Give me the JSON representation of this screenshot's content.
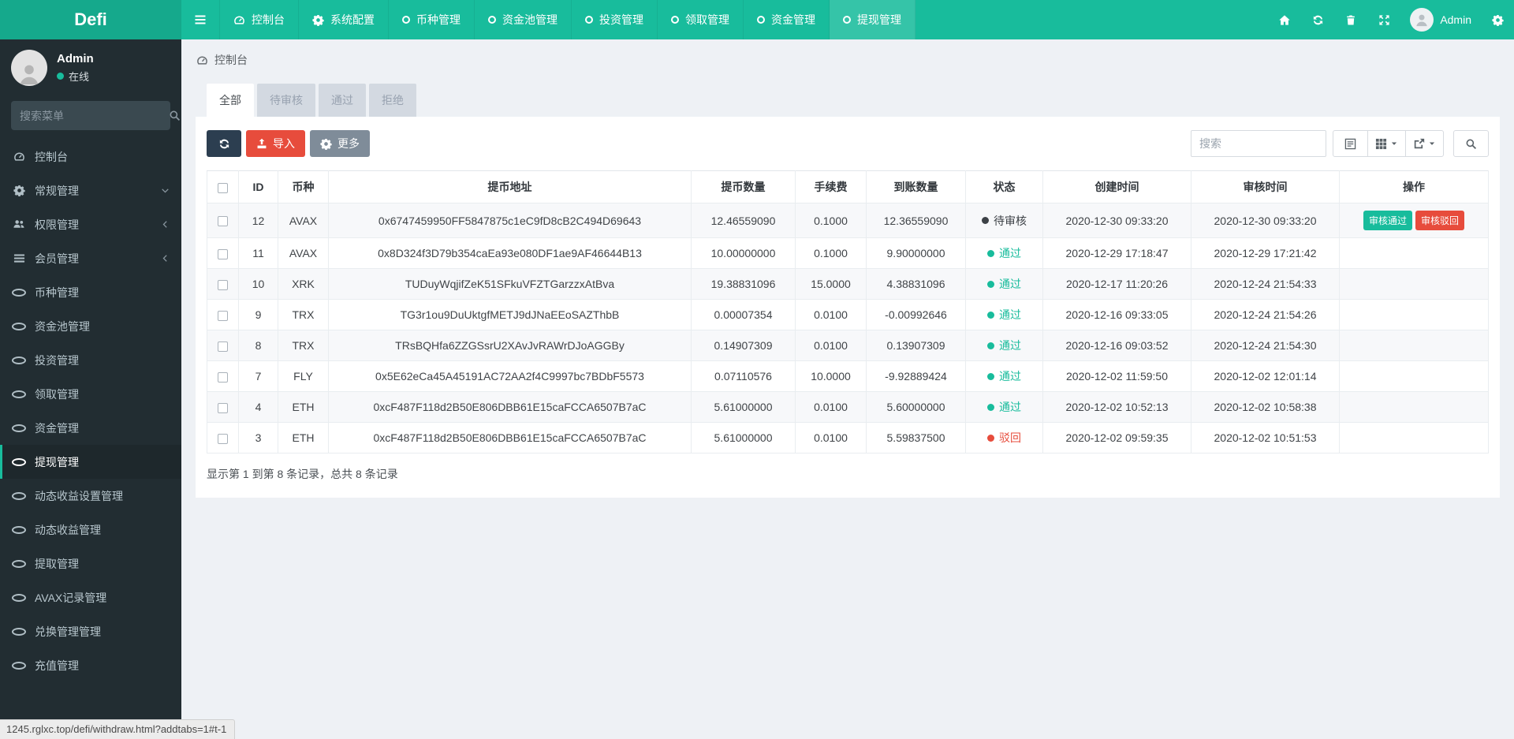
{
  "colors": {
    "accent": "#18bc9c",
    "navbar_bg": "#18bc9c",
    "logo_bg": "#15a98c",
    "sidebar_bg": "#222d32",
    "dark": "#2c3e50",
    "danger": "#e74c3c",
    "toolbar_gray": "#7f8c99",
    "pass": "#18bc9c",
    "reject": "#e74c3c",
    "pending": "#3c4146"
  },
  "navbar": {
    "logo": "Defi",
    "items": [
      {
        "key": "dashboard",
        "label": "控制台",
        "icon": "dashboard-icon",
        "active": false
      },
      {
        "key": "system",
        "label": "系统配置",
        "icon": "gear-icon",
        "active": false
      },
      {
        "key": "coin",
        "label": "币种管理",
        "icon": "circle-o-icon",
        "active": false
      },
      {
        "key": "pool",
        "label": "资金池管理",
        "icon": "circle-o-icon",
        "active": false
      },
      {
        "key": "invest",
        "label": "投资管理",
        "icon": "circle-o-icon",
        "active": false
      },
      {
        "key": "receive",
        "label": "领取管理",
        "icon": "circle-o-icon",
        "active": false
      },
      {
        "key": "funds",
        "label": "资金管理",
        "icon": "circle-o-icon",
        "active": false
      },
      {
        "key": "withdraw",
        "label": "提现管理",
        "icon": "circle-o-icon",
        "active": true
      }
    ],
    "admin_label": "Admin"
  },
  "sidebar": {
    "user": {
      "name": "Admin",
      "status_label": "在线"
    },
    "search_placeholder": "搜索菜单",
    "items": [
      {
        "key": "dashboard",
        "label": "控制台",
        "icon": "dashboard-icon",
        "arrow": "",
        "active": false
      },
      {
        "key": "general",
        "label": "常规管理",
        "icon": "gear-icon",
        "arrow": "down",
        "active": false
      },
      {
        "key": "auth",
        "label": "权限管理",
        "icon": "users-icon",
        "arrow": "left",
        "active": false
      },
      {
        "key": "member",
        "label": "会员管理",
        "icon": "list-icon",
        "arrow": "left",
        "active": false
      },
      {
        "key": "coin",
        "label": "币种管理",
        "icon": "circle-o-icon",
        "arrow": "",
        "active": false
      },
      {
        "key": "pool",
        "label": "资金池管理",
        "icon": "circle-o-icon",
        "arrow": "",
        "active": false
      },
      {
        "key": "invest",
        "label": "投资管理",
        "icon": "circle-o-icon",
        "arrow": "",
        "active": false
      },
      {
        "key": "receive",
        "label": "领取管理",
        "icon": "circle-o-icon",
        "arrow": "",
        "active": false
      },
      {
        "key": "funds",
        "label": "资金管理",
        "icon": "circle-o-icon",
        "arrow": "",
        "active": false
      },
      {
        "key": "withdraw",
        "label": "提现管理",
        "icon": "circle-o-icon",
        "arrow": "",
        "active": true
      },
      {
        "key": "dynamic-setting",
        "label": "动态收益设置管理",
        "icon": "circle-o-icon",
        "arrow": "",
        "active": false
      },
      {
        "key": "dynamic-income",
        "label": "动态收益管理",
        "icon": "circle-o-icon",
        "arrow": "",
        "active": false
      },
      {
        "key": "extract",
        "label": "提取管理",
        "icon": "circle-o-icon",
        "arrow": "",
        "active": false
      },
      {
        "key": "avax-record",
        "label": "AVAX记录管理",
        "icon": "circle-o-icon",
        "arrow": "",
        "active": false
      },
      {
        "key": "exchange",
        "label": "兑换管理管理",
        "icon": "circle-o-icon",
        "arrow": "",
        "active": false
      },
      {
        "key": "recharge",
        "label": "充值管理",
        "icon": "circle-o-icon",
        "arrow": "",
        "active": false
      }
    ]
  },
  "breadcrumb": {
    "label": "控制台"
  },
  "tabs": [
    {
      "key": "all",
      "label": "全部",
      "active": true
    },
    {
      "key": "pending",
      "label": "待审核",
      "active": false
    },
    {
      "key": "passed",
      "label": "通过",
      "active": false
    },
    {
      "key": "rejected",
      "label": "拒绝",
      "active": false
    }
  ],
  "toolbar": {
    "import_label": "导入",
    "more_label": "更多",
    "search_placeholder": "搜索"
  },
  "table": {
    "columns": [
      "ID",
      "币种",
      "提币地址",
      "提币数量",
      "手续费",
      "到账数量",
      "状态",
      "创建时间",
      "审核时间",
      "操作"
    ],
    "rows": [
      {
        "id": "12",
        "coin": "AVAX",
        "address": "0x6747459950FF5847875c1eC9fD8cB2C494D69643",
        "amount": "12.46559090",
        "fee": "0.1000",
        "received": "12.36559090",
        "status": {
          "label": "待审核",
          "type": "pending"
        },
        "created": "2020-12-30 09:33:20",
        "reviewed": "2020-12-30 09:33:20",
        "actions": [
          {
            "key": "approve",
            "label": "审核通过"
          },
          {
            "key": "reject",
            "label": "审核驳回"
          }
        ]
      },
      {
        "id": "11",
        "coin": "AVAX",
        "address": "0x8D324f3D79b354caEa93e080DF1ae9AF46644B13",
        "amount": "10.00000000",
        "fee": "0.1000",
        "received": "9.90000000",
        "status": {
          "label": "通过",
          "type": "pass"
        },
        "created": "2020-12-29 17:18:47",
        "reviewed": "2020-12-29 17:21:42",
        "actions": []
      },
      {
        "id": "10",
        "coin": "XRK",
        "address": "TUDuyWqjifZeK51SFkuVFZTGarzzxAtBva",
        "amount": "19.38831096",
        "fee": "15.0000",
        "received": "4.38831096",
        "status": {
          "label": "通过",
          "type": "pass"
        },
        "created": "2020-12-17 11:20:26",
        "reviewed": "2020-12-24 21:54:33",
        "actions": []
      },
      {
        "id": "9",
        "coin": "TRX",
        "address": "TG3r1ou9DuUktgfMETJ9dJNaEEoSAZThbB",
        "amount": "0.00007354",
        "fee": "0.0100",
        "received": "-0.00992646",
        "status": {
          "label": "通过",
          "type": "pass"
        },
        "created": "2020-12-16 09:33:05",
        "reviewed": "2020-12-24 21:54:26",
        "actions": []
      },
      {
        "id": "8",
        "coin": "TRX",
        "address": "TRsBQHfa6ZZGSsrU2XAvJvRAWrDJoAGGBy",
        "amount": "0.14907309",
        "fee": "0.0100",
        "received": "0.13907309",
        "status": {
          "label": "通过",
          "type": "pass"
        },
        "created": "2020-12-16 09:03:52",
        "reviewed": "2020-12-24 21:54:30",
        "actions": []
      },
      {
        "id": "7",
        "coin": "FLY",
        "address": "0x5E62eCa45A45191AC72AA2f4C9997bc7BDbF5573",
        "amount": "0.07110576",
        "fee": "10.0000",
        "received": "-9.92889424",
        "status": {
          "label": "通过",
          "type": "pass"
        },
        "created": "2020-12-02 11:59:50",
        "reviewed": "2020-12-02 12:01:14",
        "actions": []
      },
      {
        "id": "4",
        "coin": "ETH",
        "address": "0xcF487F118d2B50E806DBB61E15caFCCA6507B7aC",
        "amount": "5.61000000",
        "fee": "0.0100",
        "received": "5.60000000",
        "status": {
          "label": "通过",
          "type": "pass"
        },
        "created": "2020-12-02 10:52:13",
        "reviewed": "2020-12-02 10:58:38",
        "actions": []
      },
      {
        "id": "3",
        "coin": "ETH",
        "address": "0xcF487F118d2B50E806DBB61E15caFCCA6507B7aC",
        "amount": "5.61000000",
        "fee": "0.0100",
        "received": "5.59837500",
        "status": {
          "label": "驳回",
          "type": "reject"
        },
        "created": "2020-12-02 09:59:35",
        "reviewed": "2020-12-02 10:51:53",
        "actions": []
      }
    ],
    "summary": "显示第 1 到第 8 条记录，总共 8 条记录"
  },
  "statusbar": {
    "text": "1245.rglxc.top/defi/withdraw.html?addtabs=1#t-1"
  }
}
